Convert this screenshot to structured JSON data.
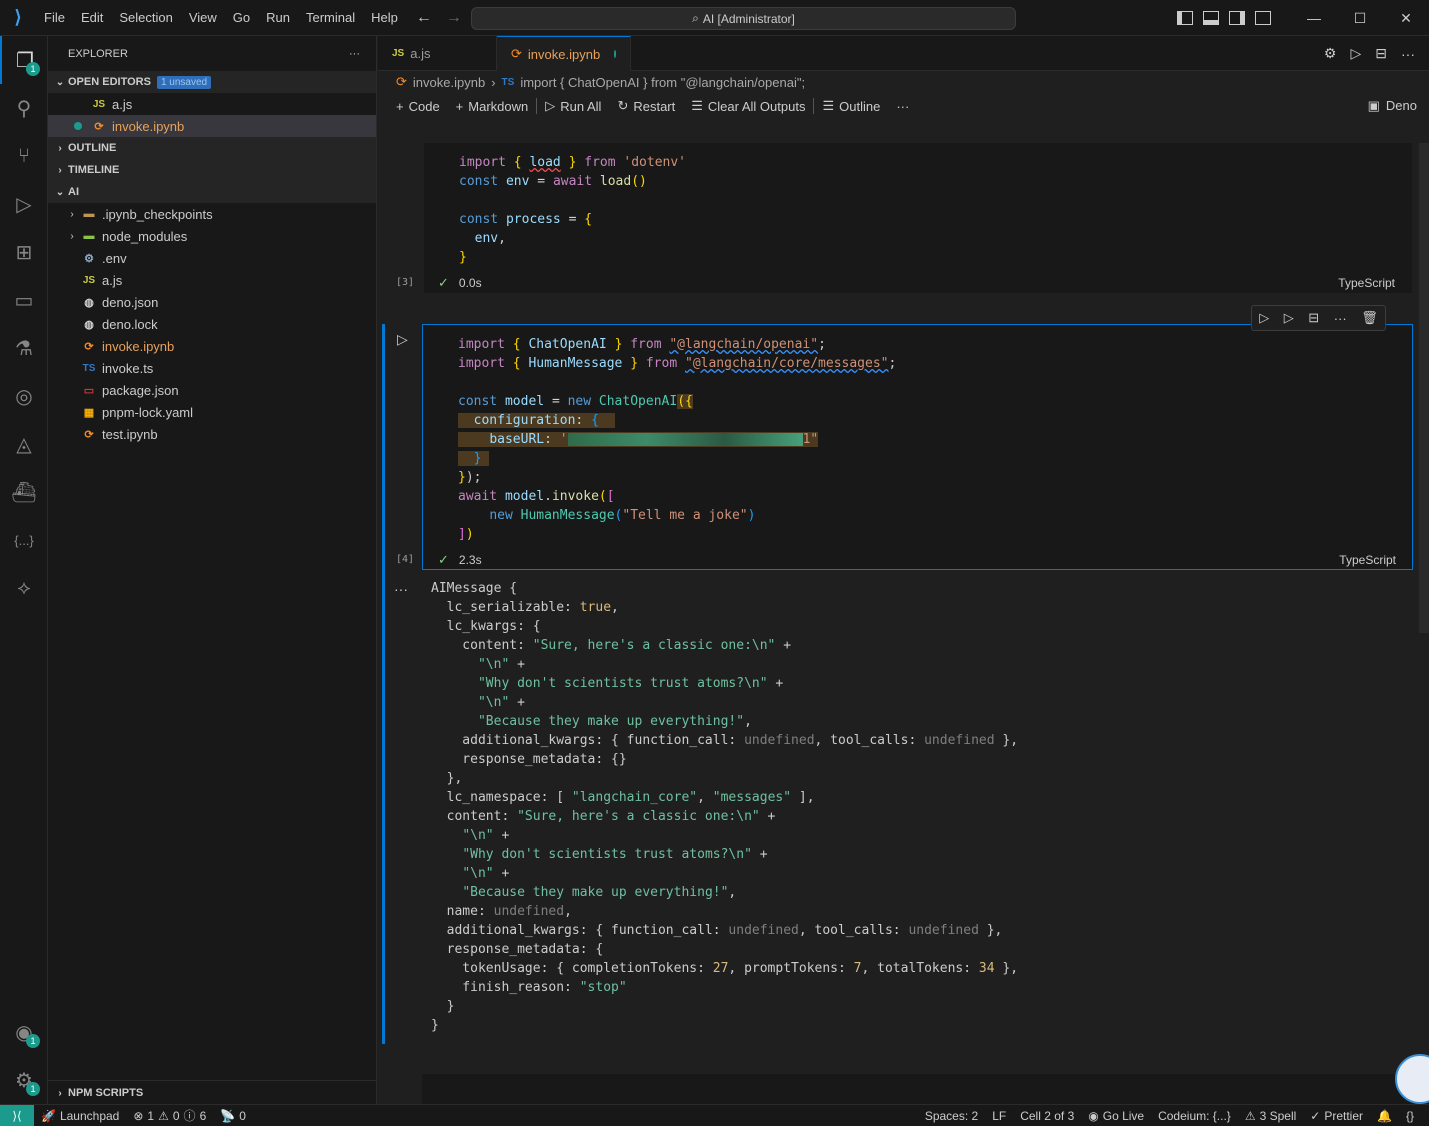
{
  "titlebar": {
    "menus": [
      "File",
      "Edit",
      "Selection",
      "View",
      "Go",
      "Run",
      "Terminal",
      "Help"
    ],
    "menu_underline": [
      "F",
      "E",
      "S",
      "V",
      "G",
      "R",
      "T",
      "H"
    ],
    "search_text": "AI [Administrator]"
  },
  "activity": {
    "explorer_badge": "1",
    "accounts_badge": "1",
    "settings_badge": "1"
  },
  "sidebar": {
    "title": "EXPLORER",
    "open_editors_label": "OPEN EDITORS",
    "unsaved_badge": "1 unsaved",
    "open_editors": [
      {
        "name": "a.js",
        "icon": "JS"
      },
      {
        "name": "invoke.ipynb",
        "icon": "notebook"
      }
    ],
    "outline_label": "OUTLINE",
    "timeline_label": "TIMELINE",
    "folder_label": "AI",
    "files": [
      {
        "name": ".ipynb_checkpoints",
        "icon": "folder"
      },
      {
        "name": "node_modules",
        "icon": "folder-node"
      },
      {
        "name": ".env",
        "icon": "gear"
      },
      {
        "name": "a.js",
        "icon": "JS"
      },
      {
        "name": "deno.json",
        "icon": "deno"
      },
      {
        "name": "deno.lock",
        "icon": "deno"
      },
      {
        "name": "invoke.ipynb",
        "icon": "notebook"
      },
      {
        "name": "invoke.ts",
        "icon": "TS"
      },
      {
        "name": "package.json",
        "icon": "npm"
      },
      {
        "name": "pnpm-lock.yaml",
        "icon": "pnpm"
      },
      {
        "name": "test.ipynb",
        "icon": "notebook"
      }
    ],
    "npm_scripts_label": "NPM SCRIPTS"
  },
  "tabs": [
    {
      "label": "a.js",
      "icon": "JS"
    },
    {
      "label": "invoke.ipynb",
      "icon": "notebook"
    }
  ],
  "breadcrumb": {
    "file": "invoke.ipynb",
    "lang_icon": "TS",
    "symbol": "import { ChatOpenAI } from \"@langchain/openai\";"
  },
  "toolbar": {
    "code": "Code",
    "markdown": "Markdown",
    "run_all": "Run All",
    "restart": "Restart",
    "clear_outputs": "Clear All Outputs",
    "outline": "Outline",
    "kernel": "Deno"
  },
  "cells": [
    {
      "exec_count": "[3]",
      "duration": "0.0s",
      "language": "TypeScript"
    },
    {
      "exec_count": "[4]",
      "duration": "2.3s",
      "language": "TypeScript"
    }
  ],
  "statusbar": {
    "launchpad": "Launchpad",
    "errors": "1",
    "warnings": "0",
    "infos": "6",
    "ports": "0",
    "spaces": "Spaces: 2",
    "eol": "LF",
    "cell": "Cell 2 of 3",
    "golive": "Go Live",
    "codeium": "Codeium: {...}",
    "spell": "3 Spell",
    "prettier": "Prettier"
  }
}
